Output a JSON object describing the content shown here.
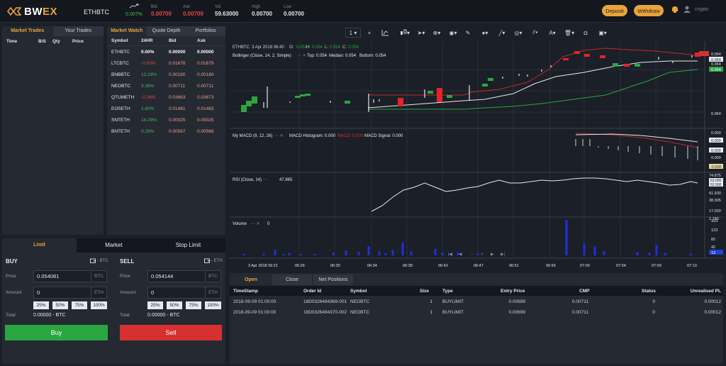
{
  "brand": {
    "name_a": "BW",
    "name_b": "EX"
  },
  "header": {
    "pair": "ETHBTC",
    "change": "0.007%",
    "stats": [
      {
        "label": "Bid",
        "value": "0.00700",
        "tone": "red"
      },
      {
        "label": "Ask",
        "value": "0.00700",
        "tone": "red"
      },
      {
        "label": "Vol",
        "value": "59.63000",
        "tone": "normal"
      },
      {
        "label": "High",
        "value": "0.00700",
        "tone": "normal"
      },
      {
        "label": "Low",
        "value": "0.00700",
        "tone": "normal"
      }
    ],
    "deposit": "Deposit",
    "withdraw": "Withdraw",
    "username": "crypto"
  },
  "trades": {
    "tabs": [
      "Market Trades",
      "Your Trades"
    ],
    "columns": [
      "Time",
      "B/S",
      "Qty",
      "Price"
    ]
  },
  "market_watch": {
    "tabs": [
      "Market Watch",
      "Quote Depth",
      "Portfolios"
    ],
    "columns": [
      "Symbol",
      "24HR",
      "Bid",
      "Ask"
    ],
    "rows": [
      {
        "symbol": "ETHBTC",
        "change": "0.00%",
        "bid": "0.00000",
        "ask": "0.00000",
        "dir": "flat"
      },
      {
        "symbol": "LTCBTC",
        "change": "-0.93%",
        "bid": "0.01678",
        "ask": "0.01679",
        "dir": "neg"
      },
      {
        "symbol": "BNBBTC",
        "change": "12.19%",
        "bid": "0.00180",
        "ask": "0.00180",
        "dir": "pos"
      },
      {
        "symbol": "NEOBTC",
        "change": "3.36%",
        "bid": "0.00711",
        "ask": "0.00711",
        "dir": "pos"
      },
      {
        "symbol": "QTUMETH",
        "change": "-0.26%",
        "bid": "0.03663",
        "ask": "0.03673",
        "dir": "neg"
      },
      {
        "symbol": "EOSETH",
        "change": "1.60%",
        "bid": "0.01481",
        "ask": "0.01483",
        "dir": "pos"
      },
      {
        "symbol": "SNTETH",
        "change": "14.29%",
        "bid": "0.00025",
        "ask": "0.00025",
        "dir": "pos"
      },
      {
        "symbol": "BNTETH",
        "change": "0.28%",
        "bid": "0.00567",
        "ask": "0.00568",
        "dir": "pos"
      }
    ]
  },
  "order_form": {
    "tabs": [
      "Limit",
      "Market",
      "Stop Limit"
    ],
    "buy": {
      "title": "BUY",
      "wallet": "- BTC",
      "price_label": "Price",
      "price": "0.054081",
      "price_unit": "BTC",
      "amount_label": "Amount",
      "amount": "0",
      "amount_unit": "ETH",
      "pcts": [
        "25%",
        "50%",
        "75%",
        "100%"
      ],
      "total_label": "Total",
      "total": "0.00000 - BTC",
      "button": "Buy"
    },
    "sell": {
      "title": "SELL",
      "wallet": "- ETH",
      "price_label": "Price",
      "price": "0.054144",
      "price_unit": "BTC",
      "amount_label": "Amount",
      "amount": "0",
      "amount_unit": "ETH",
      "pcts": [
        "25%",
        "50%",
        "75%",
        "100%"
      ],
      "total_label": "Total",
      "total": "0.00000 - BTC",
      "button": "Sell"
    }
  },
  "chart": {
    "toolbar": {
      "interval": "1"
    },
    "legend": {
      "symbol": "ETHBTC",
      "date": "3 Apr 2018 06:40",
      "o_label": "O:",
      "h_label": "H:",
      "l_label": "L:",
      "c_label": "C:",
      "o": "0.054",
      "h": "0.054",
      "l": "0.054",
      "c": "0.054"
    },
    "bollinger": {
      "name": "Bollinger (Close, 14, 2, Simple)",
      "top": "Top: 0.054",
      "median": "Median: 0.054",
      "bottom": "Bottom: 0.054"
    },
    "price_axis": {
      "p1": "0.054",
      "p2": "0.054",
      "p3": "0.054",
      "p4": "0.054",
      "p_low": "0.054"
    },
    "macd": {
      "name": "My MACD (9, 12, 26)",
      "hist": "MACD Histogram: 0.000",
      "macd": "MACD: 0.000",
      "signal": "MACD Signal: 0.000",
      "axis_top": "0.000",
      "tag1": "0.000",
      "tag2": "0.000",
      "axis_bot": "0.000",
      "tag3": "-0.000"
    },
    "rsi": {
      "name": "RSI (Close, 14)",
      "value": "47.865",
      "ticks": [
        "74.875",
        "61.500",
        "38.305",
        "17.020",
        "1.740"
      ],
      "tag1": "63.000",
      "tag2": "52.500"
    },
    "volume": {
      "name": "Volume",
      "value": "0",
      "ticks": [
        "163",
        "123",
        "82",
        "42"
      ],
      "tag": "13"
    },
    "time_axis": {
      "first": "3 Apr 2018 06:21",
      "labels": [
        "06:26",
        "06:30",
        "06:34",
        "06:38",
        "06:42",
        "06:47",
        "06:51",
        "06:56",
        "07:00",
        "07:04",
        "07:09",
        "07:13"
      ]
    }
  },
  "chart_data": {
    "type": "candlestick",
    "title": "ETHBTC",
    "x": [
      "06:21",
      "06:26",
      "06:30",
      "06:34",
      "06:38",
      "06:42",
      "06:47",
      "06:51",
      "06:56",
      "07:00",
      "07:04",
      "07:09",
      "07:13"
    ],
    "volume": [
      5,
      8,
      25,
      6,
      10,
      4,
      6,
      12,
      22,
      15,
      42,
      18,
      10,
      25,
      60,
      18,
      30,
      12,
      8,
      15,
      10,
      163,
      55,
      40,
      20,
      15,
      12,
      48,
      10,
      8
    ]
  },
  "orders": {
    "tabs": [
      "Open",
      "Close",
      "Net Positions"
    ],
    "columns": [
      "TimeStamp",
      "Order Id",
      "Symbol",
      "Size",
      "Type",
      "Entry Price",
      "CMP",
      "Status",
      "Unrealised PL"
    ],
    "rows": [
      [
        "2018-09-09 01:00:00",
        "18D0326494369-001",
        "NEOBTC",
        "1",
        "BUYLIMIT",
        "0.00699",
        "0.00711",
        "0",
        "0.00012"
      ],
      [
        "2018-09-09 01:00:00",
        "18D0326494370-002",
        "NEOBTC",
        "1",
        "BUYLIMIT",
        "0.00699",
        "0.00711",
        "0",
        "0.00012"
      ]
    ]
  },
  "colors": {
    "accent": "#e8a33a",
    "buy": "#2aa640",
    "sell": "#d63031",
    "bg": "#1b1f27",
    "panel": "#242932"
  }
}
